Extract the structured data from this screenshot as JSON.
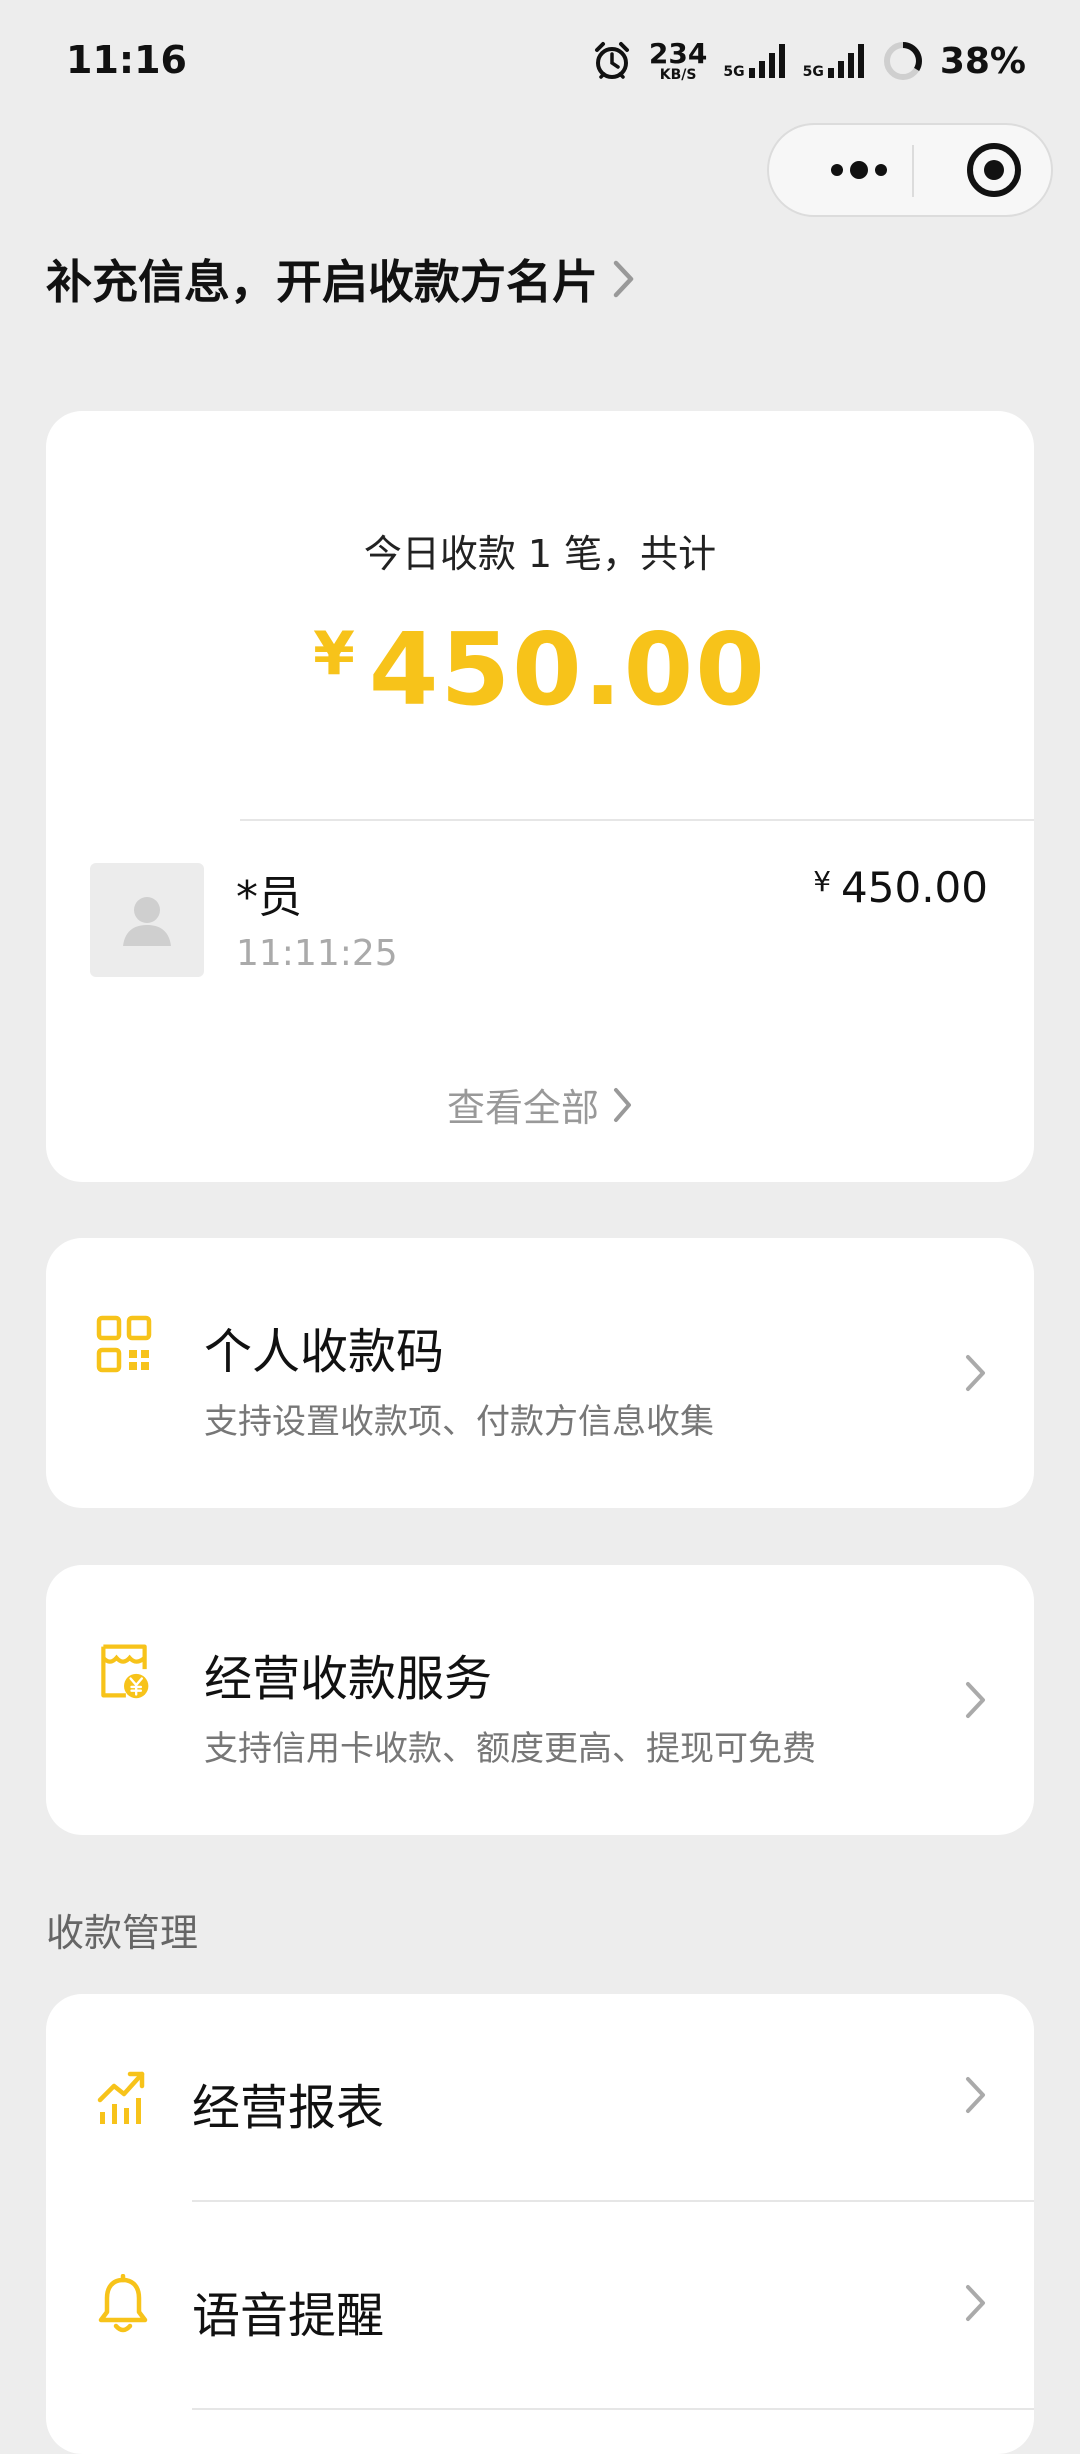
{
  "status_bar": {
    "time": "11:16",
    "net_speed_value": "234",
    "net_speed_unit": "KB/S",
    "signal_1_label": "5G",
    "signal_2_label": "5G",
    "battery_percent": "38%",
    "battery_level": 0.38
  },
  "capsule": {
    "more_icon": "more-dots-icon",
    "close_icon": "target-circle-icon"
  },
  "promo": {
    "text": "补充信息，开启收款方名片"
  },
  "summary": {
    "line": "今日收款 1 笔，共计",
    "currency": "¥",
    "amount": "450.00",
    "accent_color": "#f7c31a",
    "transaction": {
      "name": "*员",
      "time": "11:11:25",
      "currency": "¥",
      "amount": "450.00"
    },
    "view_all": "查看全部"
  },
  "features": [
    {
      "icon": "qr-code-icon",
      "title": "个人收款码",
      "subtitle": "支持设置收款项、付款方信息收集"
    },
    {
      "icon": "shop-yen-icon",
      "title": "经营收款服务",
      "subtitle": "支持信用卡收款、额度更高、提现可免费"
    }
  ],
  "management": {
    "section_title": "收款管理",
    "items": [
      {
        "icon": "chart-trend-icon",
        "label": "经营报表"
      },
      {
        "icon": "bell-icon",
        "label": "语音提醒"
      }
    ]
  }
}
